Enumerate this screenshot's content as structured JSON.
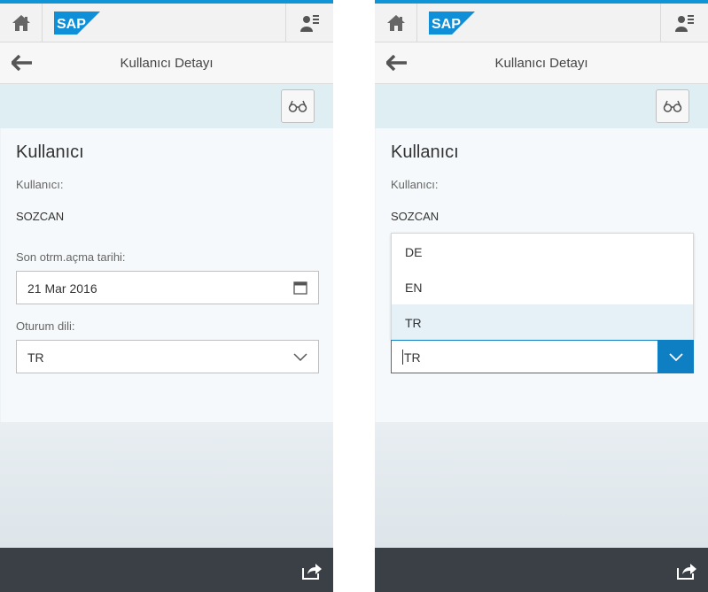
{
  "shell": {
    "logo_text": "SAP"
  },
  "page": {
    "title": "Kullanıcı Detayı"
  },
  "section": {
    "title": "Kullanıcı",
    "user_label": "Kullanıcı:",
    "user_value": "SOZCAN",
    "date_label": "Son otrm.açma tarihi:",
    "date_value": "21 Mar 2016",
    "language_label": "Oturum dili:",
    "language_value": "TR"
  },
  "dropdown": {
    "options": [
      "DE",
      "EN",
      "TR"
    ],
    "selected": "TR"
  },
  "colors": {
    "accent": "#0f94d5",
    "select_active": "#0f7fc4",
    "subheader": "#dfeef3",
    "footer": "#3a4045"
  },
  "icons": {
    "home": "home-icon",
    "user_menu": "user-menu-icon",
    "back": "back-arrow-icon",
    "display_mode": "glasses-icon",
    "calendar": "calendar-icon",
    "dropdown": "chevron-down-icon",
    "share": "share-icon"
  }
}
